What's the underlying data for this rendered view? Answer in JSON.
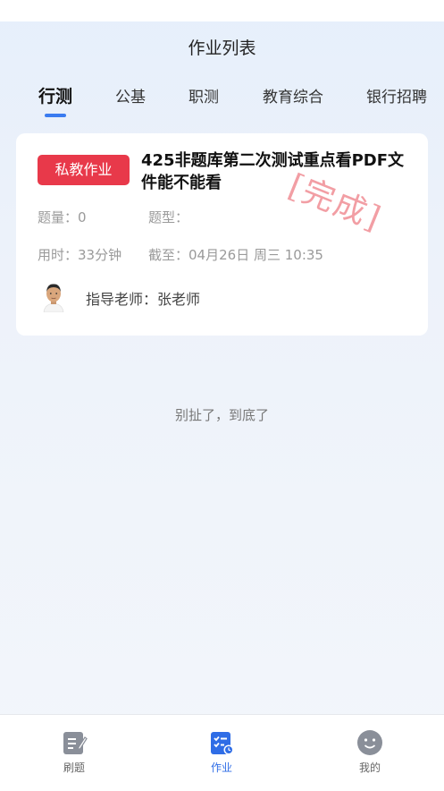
{
  "header": {
    "title": "作业列表"
  },
  "tabs": [
    {
      "label": "行测",
      "active": true
    },
    {
      "label": "公基",
      "active": false
    },
    {
      "label": "职测",
      "active": false
    },
    {
      "label": "教育综合",
      "active": false
    },
    {
      "label": "银行招聘",
      "active": false
    }
  ],
  "card": {
    "badge": "私教作业",
    "title": "425非题库第二次测试重点看PDF文件能不能看",
    "stamp": "[完成]",
    "count_label": "题量：",
    "count_value": "0",
    "type_label": "题型：",
    "type_value": "",
    "time_label": "用时：",
    "time_value": "33分钟",
    "deadline_label": "截至：",
    "deadline_value": "04月26日 周三 10:35",
    "teacher_label": "指导老师：",
    "teacher_name": "张老师"
  },
  "end_text": "别扯了，到底了",
  "bottom_nav": [
    {
      "label": "刷题",
      "icon": "practice-icon",
      "active": false
    },
    {
      "label": "作业",
      "icon": "homework-icon",
      "active": true
    },
    {
      "label": "我的",
      "icon": "profile-icon",
      "active": false
    }
  ],
  "colors": {
    "accent": "#3a7bf0",
    "badge": "#e8394a",
    "stamp": "#e84e5a"
  }
}
